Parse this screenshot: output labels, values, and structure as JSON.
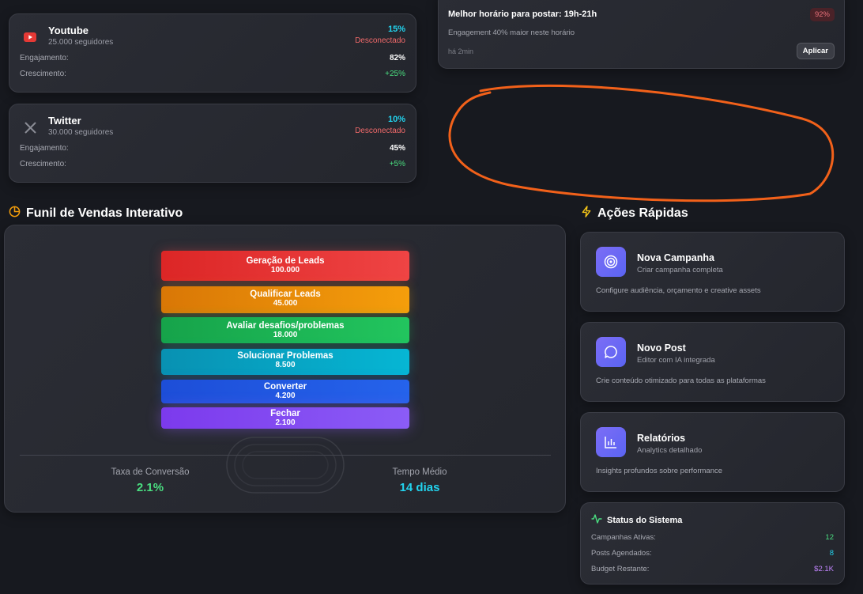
{
  "social": [
    {
      "name": "Youtube",
      "followers": "25.000 seguidores",
      "percent": "15%",
      "status": "Desconectado",
      "engagement_label": "Engajamento:",
      "engagement": "82%",
      "growth_label": "Crescimento:",
      "growth": "+25%",
      "icon": "youtube-icon"
    },
    {
      "name": "Twitter",
      "followers": "30.000 seguidores",
      "percent": "10%",
      "status": "Desconectado",
      "engagement_label": "Engajamento:",
      "engagement": "45%",
      "growth_label": "Crescimento:",
      "growth": "+5%",
      "icon": "x-twitter-icon"
    }
  ],
  "insight": {
    "title": "Melhor horário para postar: 19h-21h",
    "badge": "92%",
    "subtitle": "Engagement 40% maior neste horário",
    "time": "há 2min",
    "button": "Aplicar"
  },
  "funnel": {
    "title": "Funil de Vendas Interativo",
    "stages": [
      {
        "name": "Geração de Leads",
        "value": "100.000",
        "color": "#e53535"
      },
      {
        "name": "Qualificar Leads",
        "value": "45.000",
        "color": "#eb8c0c"
      },
      {
        "name": "Avaliar desafios/problemas",
        "value": "18.000",
        "color": "#22b455"
      },
      {
        "name": "Solucionar Problemas",
        "value": "8.500",
        "color": "#0aa6c6"
      },
      {
        "name": "Converter",
        "value": "4.200",
        "color": "#2458e0"
      },
      {
        "name": "Fechar",
        "value": "2.100",
        "color": "#7c47ee"
      }
    ],
    "conversion_label": "Taxa de Conversão",
    "conversion_value": "2.1%",
    "avg_time_label": "Tempo Médio",
    "avg_time_value": "14 dias"
  },
  "quick_actions": {
    "title": "Ações Rápidas",
    "items": [
      {
        "title": "Nova Campanha",
        "subtitle": "Criar campanha completa",
        "desc": "Configure audiência, orçamento e creative assets",
        "icon": "target-icon"
      },
      {
        "title": "Novo Post",
        "subtitle": "Editor com IA integrada",
        "desc": "Crie conteúdo otimizado para todas as plataformas",
        "icon": "chat-bubble-icon"
      },
      {
        "title": "Relatórios",
        "subtitle": "Analytics detalhado",
        "desc": "Insights profundos sobre performance",
        "icon": "bar-chart-icon"
      }
    ]
  },
  "system_status": {
    "title": "Status do Sistema",
    "rows": [
      {
        "label": "Campanhas Ativas:",
        "value": "12",
        "color": "#4ade80"
      },
      {
        "label": "Posts Agendados:",
        "value": "8",
        "color": "#22d3ee"
      },
      {
        "label": "Budget Restante:",
        "value": "$2.1K",
        "color": "#c084fc"
      }
    ]
  },
  "colors": {
    "accent_orange": "#f59e0b",
    "accent_cyan": "#22d3ee",
    "accent_green": "#4ade80"
  }
}
